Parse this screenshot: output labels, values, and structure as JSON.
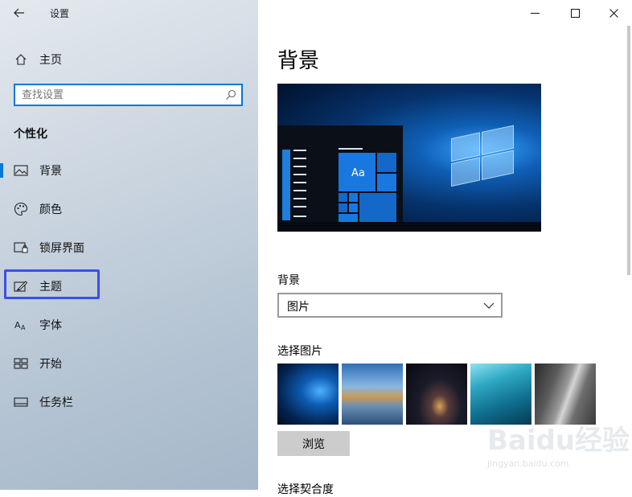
{
  "app": {
    "title": "设置"
  },
  "sidebar": {
    "home_label": "主页",
    "search_placeholder": "查找设置",
    "section_title": "个性化",
    "items": [
      {
        "label": "背景",
        "icon": "picture-icon",
        "selected": true
      },
      {
        "label": "颜色",
        "icon": "palette-icon",
        "selected": false
      },
      {
        "label": "锁屏界面",
        "icon": "lock-screen-icon",
        "selected": false
      },
      {
        "label": "主题",
        "icon": "theme-brush-icon",
        "selected": false,
        "highlighted": true
      },
      {
        "label": "字体",
        "icon": "font-icon",
        "selected": false
      },
      {
        "label": "开始",
        "icon": "start-grid-icon",
        "selected": false
      },
      {
        "label": "任务栏",
        "icon": "taskbar-icon",
        "selected": false
      }
    ]
  },
  "main": {
    "page_title": "背景",
    "preview": {
      "sample_text": "Aa"
    },
    "background_label": "背景",
    "background_value": "图片",
    "choose_picture_label": "选择图片",
    "browse_label": "浏览",
    "choose_fit_label": "选择契合度",
    "thumbnails": [
      "windows-blue-light",
      "beach-rock-arch",
      "night-sky-tent",
      "underwater-swimmer",
      "grey-rock-cliff"
    ]
  },
  "watermark": {
    "brand": "Baidu经验",
    "url": "jingyan.baidu.com"
  },
  "colors": {
    "accent": "#0078d7",
    "highlight_box": "#3b4fe8",
    "button_gray": "#cccccc"
  }
}
